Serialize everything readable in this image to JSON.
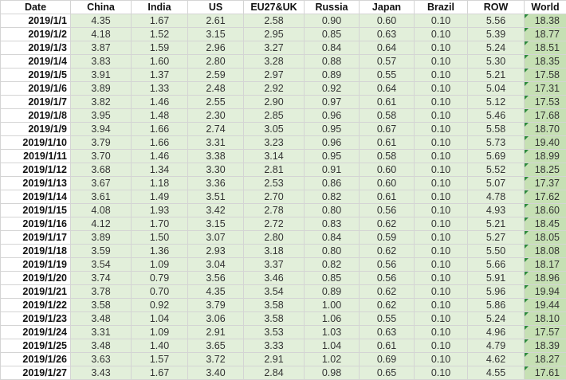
{
  "sheet": {
    "columns": [
      "Date",
      "China",
      "India",
      "US",
      "EU27&UK",
      "Russia",
      "Japan",
      "Brazil",
      "ROW",
      "World"
    ],
    "rows": [
      {
        "date": "2019/1/1",
        "values": [
          "4.35",
          "1.67",
          "2.61",
          "2.58",
          "0.90",
          "0.60",
          "0.10",
          "5.56",
          "18.38"
        ]
      },
      {
        "date": "2019/1/2",
        "values": [
          "4.18",
          "1.52",
          "3.15",
          "2.95",
          "0.85",
          "0.63",
          "0.10",
          "5.39",
          "18.77"
        ]
      },
      {
        "date": "2019/1/3",
        "values": [
          "3.87",
          "1.59",
          "2.96",
          "3.27",
          "0.84",
          "0.64",
          "0.10",
          "5.24",
          "18.51"
        ]
      },
      {
        "date": "2019/1/4",
        "values": [
          "3.83",
          "1.60",
          "2.80",
          "3.28",
          "0.88",
          "0.57",
          "0.10",
          "5.30",
          "18.35"
        ]
      },
      {
        "date": "2019/1/5",
        "values": [
          "3.91",
          "1.37",
          "2.59",
          "2.97",
          "0.89",
          "0.55",
          "0.10",
          "5.21",
          "17.58"
        ]
      },
      {
        "date": "2019/1/6",
        "values": [
          "3.89",
          "1.33",
          "2.48",
          "2.92",
          "0.92",
          "0.64",
          "0.10",
          "5.04",
          "17.31"
        ]
      },
      {
        "date": "2019/1/7",
        "values": [
          "3.82",
          "1.46",
          "2.55",
          "2.90",
          "0.97",
          "0.61",
          "0.10",
          "5.12",
          "17.53"
        ]
      },
      {
        "date": "2019/1/8",
        "values": [
          "3.95",
          "1.48",
          "2.30",
          "2.85",
          "0.96",
          "0.58",
          "0.10",
          "5.46",
          "17.68"
        ]
      },
      {
        "date": "2019/1/9",
        "values": [
          "3.94",
          "1.66",
          "2.74",
          "3.05",
          "0.95",
          "0.67",
          "0.10",
          "5.58",
          "18.70"
        ]
      },
      {
        "date": "2019/1/10",
        "values": [
          "3.79",
          "1.66",
          "3.31",
          "3.23",
          "0.96",
          "0.61",
          "0.10",
          "5.73",
          "19.40"
        ]
      },
      {
        "date": "2019/1/11",
        "values": [
          "3.70",
          "1.46",
          "3.38",
          "3.14",
          "0.95",
          "0.58",
          "0.10",
          "5.69",
          "18.99"
        ]
      },
      {
        "date": "2019/1/12",
        "values": [
          "3.68",
          "1.34",
          "3.30",
          "2.81",
          "0.91",
          "0.60",
          "0.10",
          "5.52",
          "18.25"
        ]
      },
      {
        "date": "2019/1/13",
        "values": [
          "3.67",
          "1.18",
          "3.36",
          "2.53",
          "0.86",
          "0.60",
          "0.10",
          "5.07",
          "17.37"
        ]
      },
      {
        "date": "2019/1/14",
        "values": [
          "3.61",
          "1.49",
          "3.51",
          "2.70",
          "0.82",
          "0.61",
          "0.10",
          "4.78",
          "17.62"
        ]
      },
      {
        "date": "2019/1/15",
        "values": [
          "4.08",
          "1.93",
          "3.42",
          "2.78",
          "0.80",
          "0.56",
          "0.10",
          "4.93",
          "18.60"
        ]
      },
      {
        "date": "2019/1/16",
        "values": [
          "4.12",
          "1.70",
          "3.15",
          "2.72",
          "0.83",
          "0.62",
          "0.10",
          "5.21",
          "18.45"
        ]
      },
      {
        "date": "2019/1/17",
        "values": [
          "3.89",
          "1.50",
          "3.07",
          "2.80",
          "0.84",
          "0.59",
          "0.10",
          "5.27",
          "18.05"
        ]
      },
      {
        "date": "2019/1/18",
        "values": [
          "3.59",
          "1.36",
          "2.93",
          "3.18",
          "0.80",
          "0.62",
          "0.10",
          "5.50",
          "18.08"
        ]
      },
      {
        "date": "2019/1/19",
        "values": [
          "3.54",
          "1.09",
          "3.04",
          "3.37",
          "0.82",
          "0.56",
          "0.10",
          "5.66",
          "18.17"
        ]
      },
      {
        "date": "2019/1/20",
        "values": [
          "3.74",
          "0.79",
          "3.56",
          "3.46",
          "0.85",
          "0.56",
          "0.10",
          "5.91",
          "18.96"
        ]
      },
      {
        "date": "2019/1/21",
        "values": [
          "3.78",
          "0.70",
          "4.35",
          "3.54",
          "0.89",
          "0.62",
          "0.10",
          "5.96",
          "19.94"
        ]
      },
      {
        "date": "2019/1/22",
        "values": [
          "3.58",
          "0.92",
          "3.79",
          "3.58",
          "1.00",
          "0.62",
          "0.10",
          "5.86",
          "19.44"
        ]
      },
      {
        "date": "2019/1/23",
        "values": [
          "3.48",
          "1.04",
          "3.06",
          "3.58",
          "1.06",
          "0.55",
          "0.10",
          "5.24",
          "18.10"
        ]
      },
      {
        "date": "2019/1/24",
        "values": [
          "3.31",
          "1.09",
          "2.91",
          "3.53",
          "1.03",
          "0.63",
          "0.10",
          "4.96",
          "17.57"
        ]
      },
      {
        "date": "2019/1/25",
        "values": [
          "3.48",
          "1.40",
          "3.65",
          "3.33",
          "1.04",
          "0.61",
          "0.10",
          "4.79",
          "18.39"
        ]
      },
      {
        "date": "2019/1/26",
        "values": [
          "3.63",
          "1.57",
          "3.72",
          "2.91",
          "1.02",
          "0.69",
          "0.10",
          "4.62",
          "18.27"
        ]
      },
      {
        "date": "2019/1/27",
        "values": [
          "3.43",
          "1.67",
          "3.40",
          "2.84",
          "0.98",
          "0.65",
          "0.10",
          "4.55",
          "17.61"
        ]
      }
    ]
  },
  "colors": {
    "cell_fill": "#e2efda",
    "world_fill": "#c6e0b4",
    "gridline": "#d4d4d4",
    "error_indicator": "#2e8b3d"
  }
}
